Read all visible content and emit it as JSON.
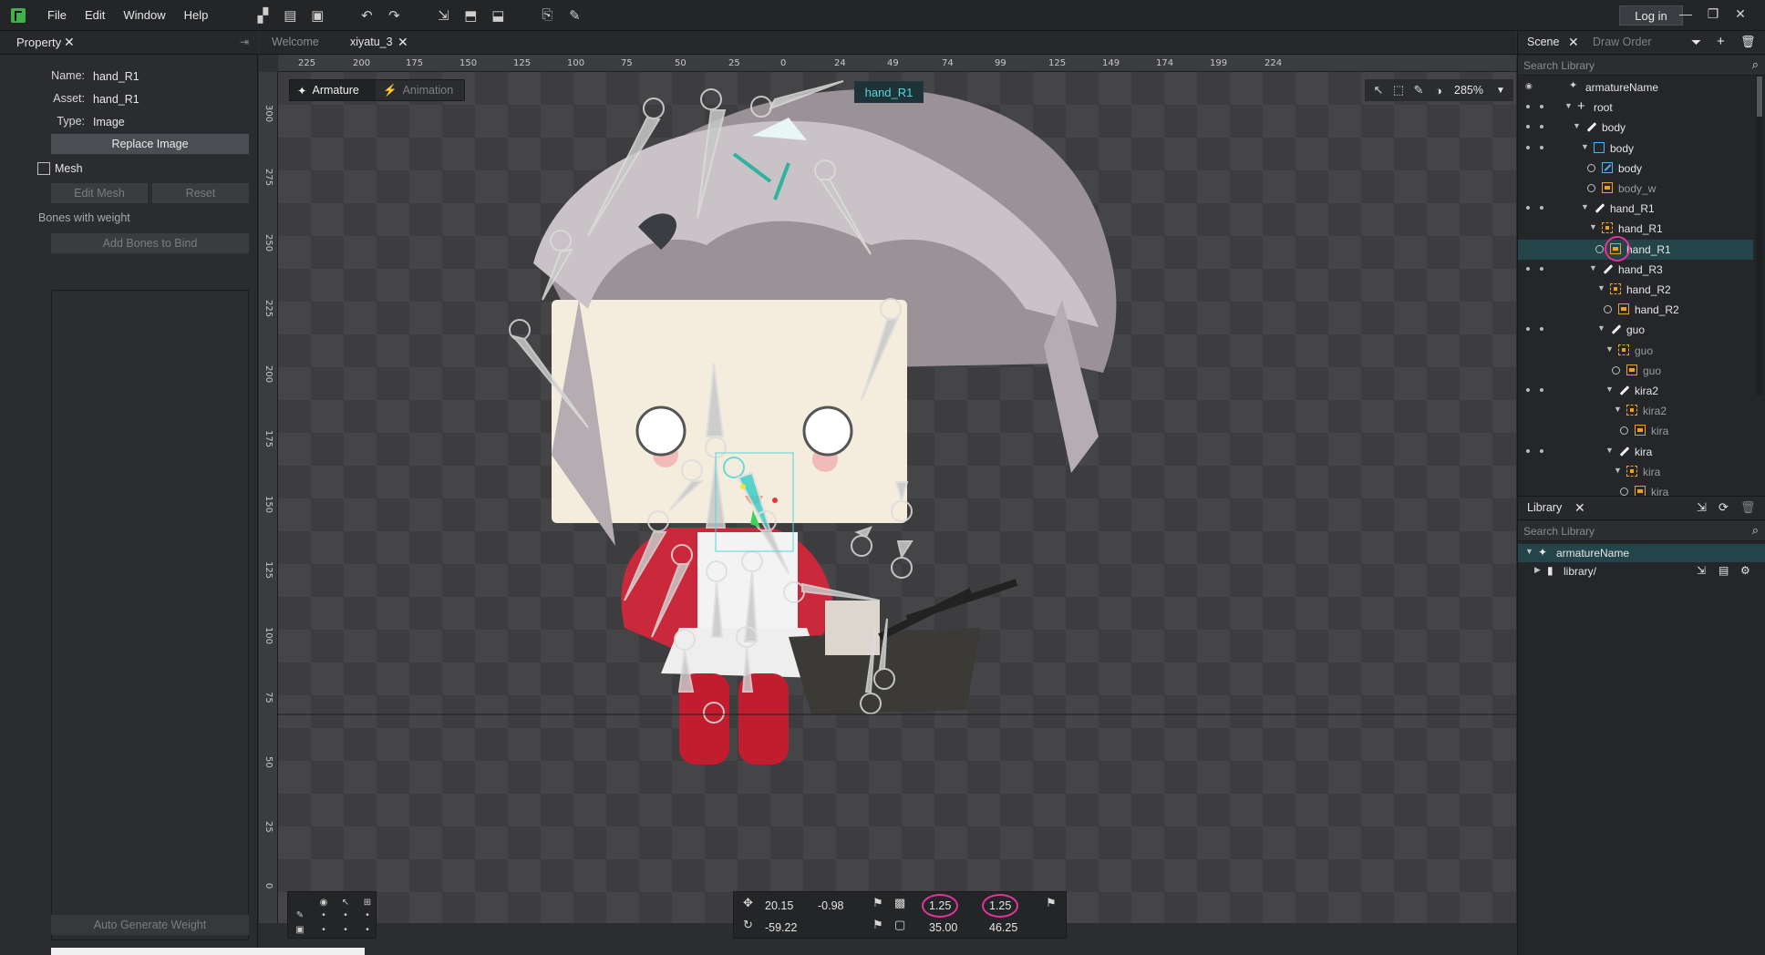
{
  "menubar": {
    "items": [
      "File",
      "Edit",
      "Window",
      "Help"
    ],
    "login_label": "Log in"
  },
  "property": {
    "tab_label": "Property",
    "name_key": "Name:",
    "name_value": "hand_R1",
    "asset_key": "Asset:",
    "asset_value": "hand_R1",
    "type_key": "Type:",
    "type_value": "Image",
    "replace_image": "Replace Image",
    "mesh_label": "Mesh",
    "edit_mesh": "Edit Mesh",
    "reset": "Reset",
    "bones_with_weight": "Bones with weight",
    "add_bones": "Add Bones to Bind",
    "auto_generate": "Auto Generate Weight"
  },
  "doc_tabs": {
    "welcome": "Welcome",
    "file": "xiyatu_3"
  },
  "ruler": {
    "top": [
      "225",
      "200",
      "175",
      "150",
      "125",
      "100",
      "75",
      "50",
      "25",
      "0",
      "24",
      "49",
      "74",
      "99",
      "125",
      "149",
      "174",
      "199",
      "224"
    ],
    "left": [
      "300",
      "275",
      "250",
      "225",
      "200",
      "175",
      "150",
      "125",
      "100",
      "75",
      "50",
      "25",
      "0"
    ]
  },
  "canvas": {
    "mode_armature": "Armature",
    "mode_animation": "Animation",
    "selected_label": "hand_R1",
    "zoom": "285%"
  },
  "transform": {
    "x": "20.15",
    "y": "-0.98",
    "scale_x": "1.25",
    "scale_y": "1.25",
    "rotation": "-59.22",
    "width": "35.00",
    "height": "46.25"
  },
  "scene": {
    "tab_scene": "Scene",
    "tab_draw_order": "Draw Order",
    "search_placeholder": "Search Library",
    "tree": [
      {
        "label": "armatureName",
        "icon": "armature",
        "indent": 0
      },
      {
        "label": "root",
        "icon": "root",
        "indent": 1
      },
      {
        "label": "body",
        "icon": "bone",
        "indent": 2
      },
      {
        "label": "body",
        "icon": "group",
        "indent": 3
      },
      {
        "label": "body",
        "icon": "mesh",
        "indent": 4
      },
      {
        "label": "body_w",
        "icon": "img",
        "indent": 4
      },
      {
        "label": "hand_R1",
        "icon": "bone",
        "indent": 3
      },
      {
        "label": "hand_R1",
        "icon": "slot",
        "indent": 4
      },
      {
        "label": "hand_R1",
        "icon": "img",
        "indent": 5
      },
      {
        "label": "hand_R3",
        "icon": "bone",
        "indent": 4
      },
      {
        "label": "hand_R2",
        "icon": "slot",
        "indent": 5
      },
      {
        "label": "hand_R2",
        "icon": "img",
        "indent": 6
      },
      {
        "label": "guo",
        "icon": "bone",
        "indent": 5
      },
      {
        "label": "guo",
        "icon": "slot",
        "indent": 6
      },
      {
        "label": "guo",
        "icon": "img",
        "indent": 7
      },
      {
        "label": "kira2",
        "icon": "bone",
        "indent": 6
      },
      {
        "label": "kira2",
        "icon": "slot",
        "indent": 7
      },
      {
        "label": "kira",
        "icon": "img",
        "indent": 8
      },
      {
        "label": "kira",
        "icon": "bone",
        "indent": 6
      },
      {
        "label": "kira",
        "icon": "slot",
        "indent": 7
      },
      {
        "label": "kira",
        "icon": "img",
        "indent": 8
      }
    ]
  },
  "library": {
    "tab_label": "Library",
    "search_placeholder": "Search Library",
    "items": [
      {
        "label": "armatureName"
      },
      {
        "label": "library/"
      }
    ]
  },
  "colors": {
    "accent": "#52d6dc",
    "highlight_ring": "#e0359e",
    "selection": "#23454a"
  }
}
